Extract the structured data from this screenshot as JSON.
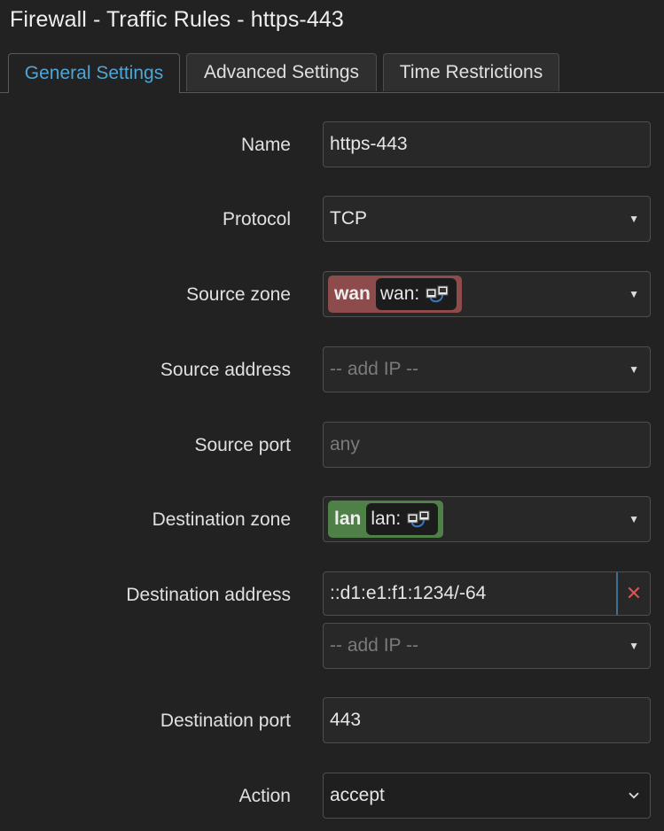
{
  "page": {
    "title": "Firewall - Traffic Rules - https-443"
  },
  "tabs": [
    {
      "label": "General Settings",
      "active": true
    },
    {
      "label": "Advanced Settings",
      "active": false
    },
    {
      "label": "Time Restrictions",
      "active": false
    }
  ],
  "form": {
    "name": {
      "label": "Name",
      "value": "https-443"
    },
    "protocol": {
      "label": "Protocol",
      "value": "TCP"
    },
    "source_zone": {
      "label": "Source zone",
      "zone": "wan",
      "network": "wan:",
      "color": "#8e4b4b"
    },
    "source_address": {
      "label": "Source address",
      "placeholder": "-- add IP --"
    },
    "source_port": {
      "label": "Source port",
      "placeholder": "any"
    },
    "destination_zone": {
      "label": "Destination zone",
      "zone": "lan",
      "network": "lan:",
      "color": "#4f8048"
    },
    "destination_address": {
      "label": "Destination address",
      "value": "::d1:e1:f1:1234/-64",
      "remove_symbol": "✕",
      "placeholder": "-- add IP --"
    },
    "destination_port": {
      "label": "Destination port",
      "value": "443"
    },
    "action": {
      "label": "Action",
      "value": "accept"
    }
  },
  "icons": {
    "dropdown": "caret-down-icon",
    "network": "network-ports-icon",
    "select_chevron": "chevron-down-icon",
    "remove": "remove-icon"
  }
}
